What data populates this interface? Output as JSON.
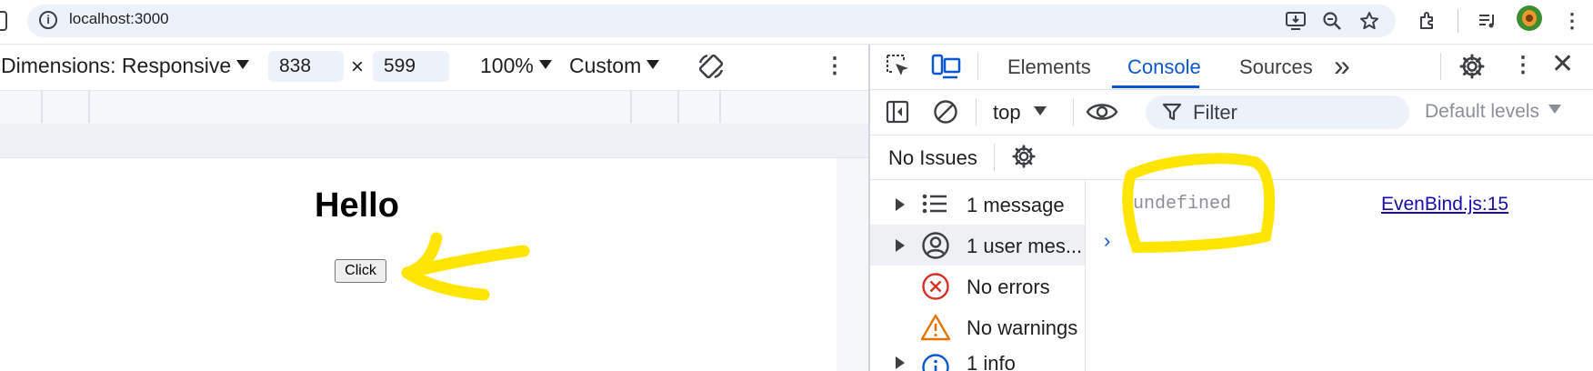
{
  "browser": {
    "url": "localhost:3000"
  },
  "device_toolbar": {
    "dimensions_label": "Dimensions: Responsive",
    "width_value": "838",
    "times_symbol": "×",
    "height_value": "599",
    "zoom": "100%",
    "throttle": "Custom"
  },
  "page": {
    "heading": "Hello",
    "button_label": "Click"
  },
  "devtools": {
    "tabs": [
      "Elements",
      "Console",
      "Sources"
    ],
    "active_tab": "Console",
    "more_tabs": "»",
    "context": "top",
    "filter_placeholder": "Filter",
    "levels": "Default levels",
    "issues": "No Issues"
  },
  "console_sidebar": {
    "items": [
      {
        "label": "1 message",
        "icon": "list-icon",
        "expandable": true
      },
      {
        "label": "1 user mes...",
        "icon": "user-icon",
        "expandable": true,
        "selected": true
      },
      {
        "label": "No errors",
        "icon": "error-icon",
        "expandable": false
      },
      {
        "label": "No warnings",
        "icon": "warning-icon",
        "expandable": false
      },
      {
        "label": "1 info",
        "icon": "info-icon",
        "expandable": true
      }
    ]
  },
  "console_output": {
    "message": "undefined",
    "source": "EvenBind.js:15",
    "prompt_symbol": "›"
  },
  "colors": {
    "accent": "#0b57d0",
    "annotation": "#ffe500",
    "error": "#d93025",
    "warning": "#e37400"
  }
}
